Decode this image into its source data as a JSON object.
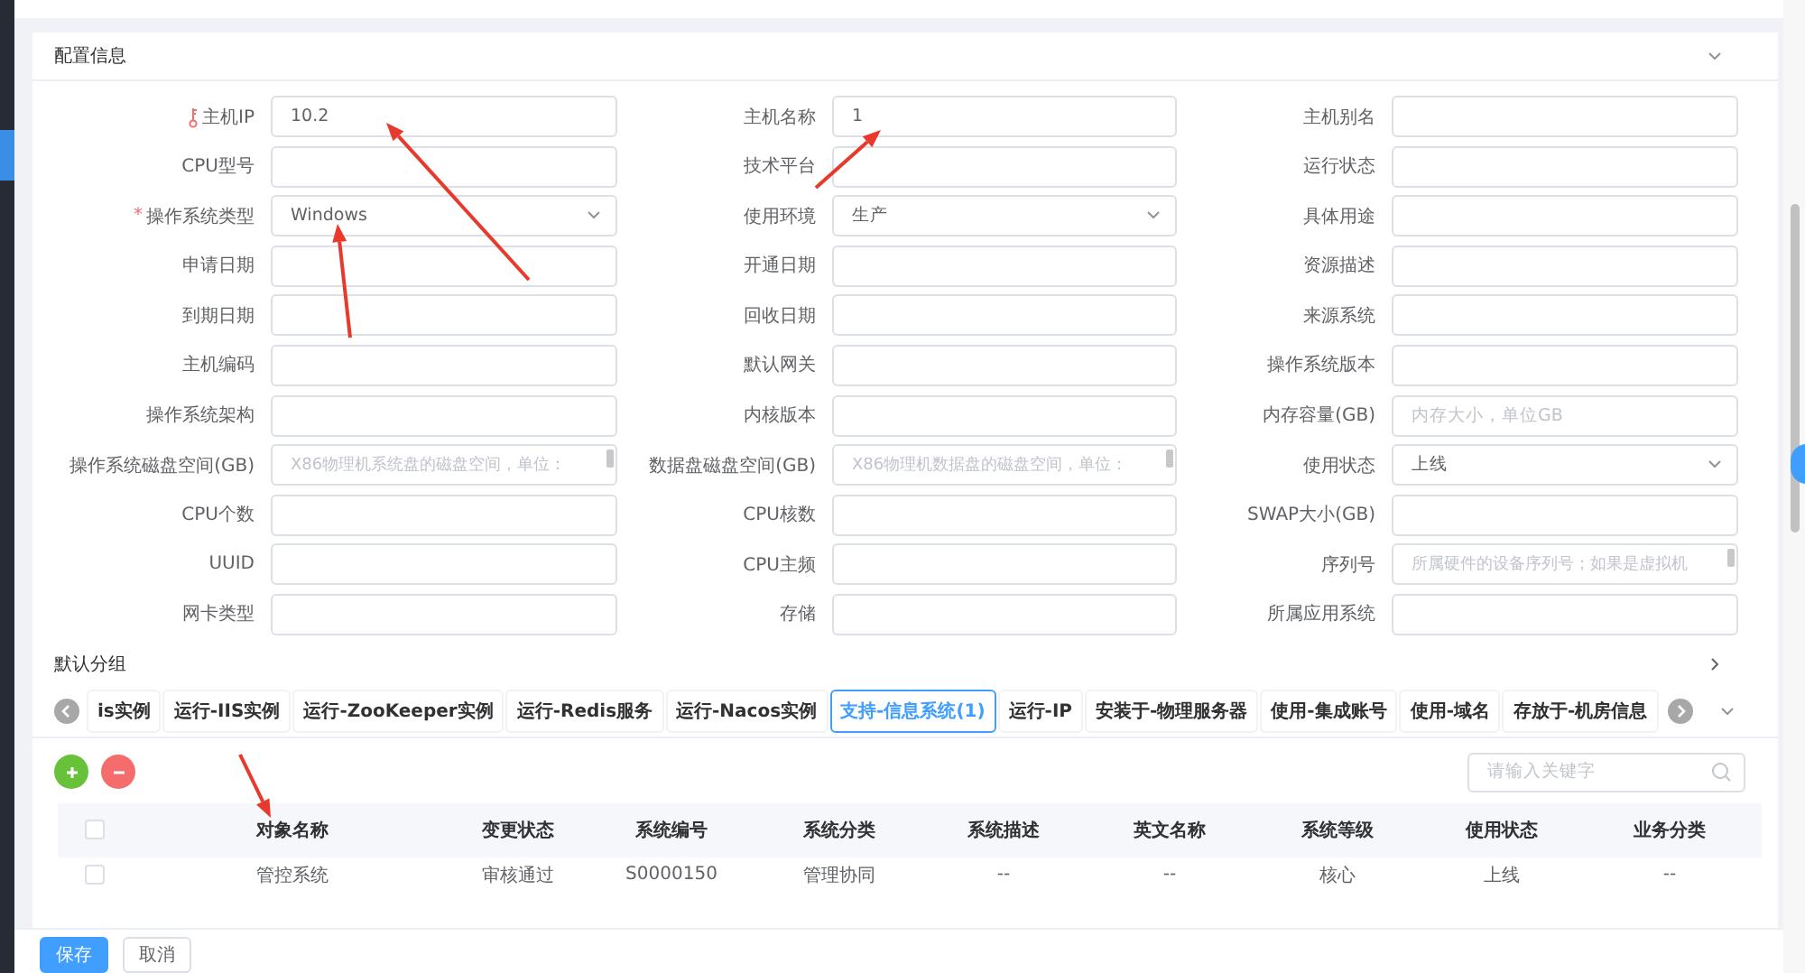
{
  "config_section": {
    "title": "配置信息",
    "expanded": true,
    "fields": [
      {
        "label": "主机IP",
        "kind": "text",
        "value": "10.2",
        "key_marked": true
      },
      {
        "label": "主机名称",
        "kind": "text",
        "value": "1",
        "key_marked": false
      },
      {
        "label": "主机别名",
        "kind": "text",
        "key_marked": false
      },
      {
        "label": "CPU型号",
        "kind": "text",
        "key_marked": false
      },
      {
        "label": "技术平台",
        "kind": "text",
        "key_marked": false
      },
      {
        "label": "运行状态",
        "kind": "text",
        "key_marked": false
      },
      {
        "label": "操作系统类型",
        "kind": "select",
        "value": "Windows",
        "required_mark": "*",
        "key_marked": false
      },
      {
        "label": "使用环境",
        "kind": "select",
        "value": "生产",
        "key_marked": false
      },
      {
        "label": "具体用途",
        "kind": "text",
        "key_marked": false
      },
      {
        "label": "申请日期",
        "kind": "text",
        "key_marked": false
      },
      {
        "label": "开通日期",
        "kind": "text",
        "key_marked": false
      },
      {
        "label": "资源描述",
        "kind": "text",
        "key_marked": false
      },
      {
        "label": "到期日期",
        "kind": "text",
        "key_marked": false
      },
      {
        "label": "回收日期",
        "kind": "text",
        "key_marked": false
      },
      {
        "label": "来源系统",
        "kind": "text",
        "key_marked": false
      },
      {
        "label": "主机编码",
        "kind": "text",
        "key_marked": false
      },
      {
        "label": "默认网关",
        "kind": "text",
        "key_marked": false
      },
      {
        "label": "操作系统版本",
        "kind": "text",
        "key_marked": false
      },
      {
        "label": "操作系统架构",
        "kind": "text",
        "key_marked": false
      },
      {
        "label": "内核版本",
        "kind": "text",
        "key_marked": false
      },
      {
        "label": "内存容量(GB)",
        "kind": "text",
        "placeholder": "内存大小，单位GB",
        "key_marked": false
      },
      {
        "label": "操作系统磁盘空间(GB)",
        "kind": "textarea",
        "placeholder": "X86物理机系统盘的磁盘空间，单位：",
        "key_marked": false
      },
      {
        "label": "数据盘磁盘空间(GB)",
        "kind": "textarea",
        "placeholder": "X86物理机数据盘的磁盘空间，单位：",
        "key_marked": false
      },
      {
        "label": "使用状态",
        "kind": "select",
        "value": "上线",
        "key_marked": false
      },
      {
        "label": "CPU个数",
        "kind": "text",
        "key_marked": false
      },
      {
        "label": "CPU核数",
        "kind": "text",
        "key_marked": false
      },
      {
        "label": "SWAP大小(GB)",
        "kind": "text",
        "key_marked": false
      },
      {
        "label": "UUID",
        "kind": "text",
        "key_marked": false
      },
      {
        "label": "CPU主频",
        "kind": "text",
        "key_marked": false
      },
      {
        "label": "序列号",
        "kind": "textarea",
        "placeholder": "所属硬件的设备序列号；如果是虚拟机",
        "key_marked": false
      },
      {
        "label": "网卡类型",
        "kind": "text",
        "key_marked": false
      },
      {
        "label": "存储",
        "kind": "text",
        "key_marked": false
      },
      {
        "label": "所属应用系统",
        "kind": "text",
        "key_marked": false
      }
    ]
  },
  "group_section": {
    "title": "默认分组",
    "expanded": false,
    "tabs": [
      {
        "label": "is实例",
        "selected": false
      },
      {
        "label": "运行-IIS实例",
        "selected": false
      },
      {
        "label": "运行-ZooKeeper实例",
        "selected": false
      },
      {
        "label": "运行-Redis服务",
        "selected": false
      },
      {
        "label": "运行-Nacos实例",
        "selected": false
      },
      {
        "label": "支持-信息系统(1)",
        "selected": true
      },
      {
        "label": "运行-IP",
        "selected": false
      },
      {
        "label": "安装于-物理服务器",
        "selected": false
      },
      {
        "label": "使用-集成账号",
        "selected": false
      },
      {
        "label": "使用-域名",
        "selected": false
      },
      {
        "label": "存放于-机房信息",
        "selected": false
      }
    ],
    "search": {
      "placeholder": "请输入关键字"
    },
    "table": {
      "select_all": {
        "checked": false
      },
      "columns": [
        "对象名称",
        "变更状态",
        "系统编号",
        "系统分类",
        "系统描述",
        "英文名称",
        "系统等级",
        "使用状态",
        "业务分类"
      ],
      "rows": [
        {
          "checked": false,
          "cells": [
            "管控系统",
            "审核通过",
            "S0000150",
            "管理协同",
            "--",
            "--",
            "核心",
            "上线",
            "--"
          ]
        }
      ]
    }
  },
  "footer": {
    "buttons": [
      {
        "label": "保存",
        "kind": "primary"
      },
      {
        "label": "取消",
        "kind": "plain"
      }
    ]
  }
}
